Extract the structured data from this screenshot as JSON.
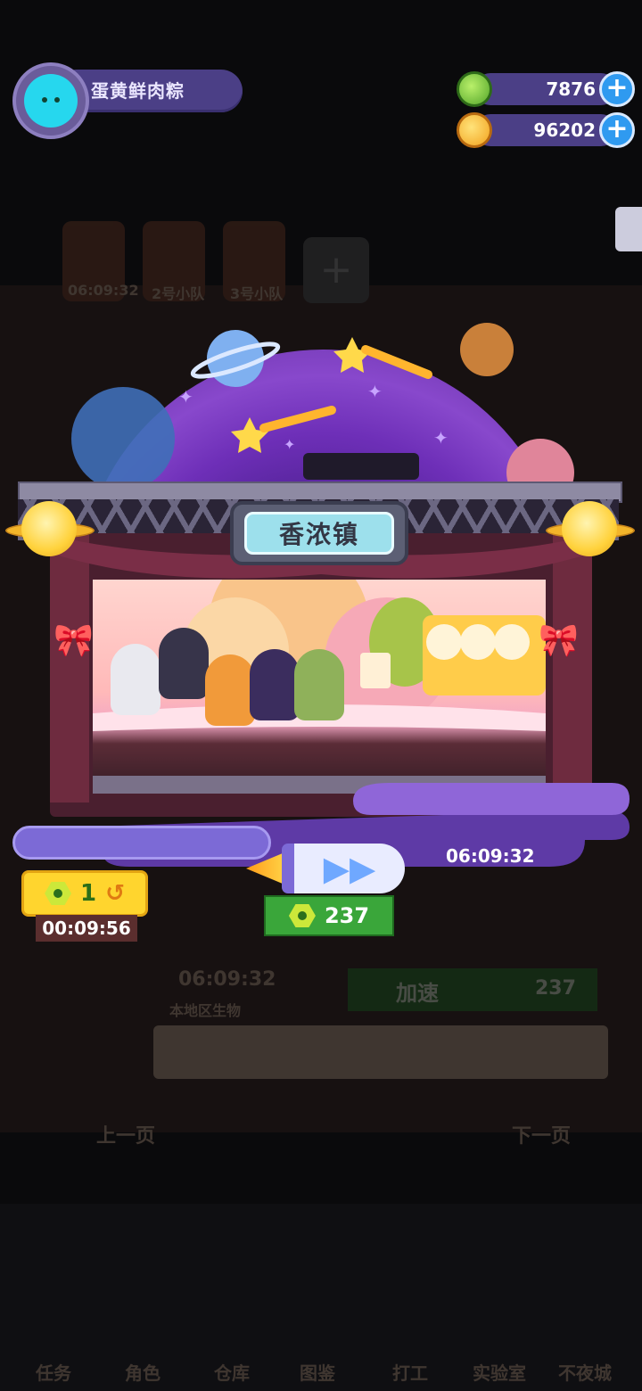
{
  "player": {
    "name": "蛋黄鲜肉粽"
  },
  "currencies": [
    {
      "name": "green-gem",
      "value": "7876",
      "color": "#6fc83a"
    },
    {
      "name": "gold-coin",
      "value": "96202",
      "color": "#f4b21c"
    }
  ],
  "stage": {
    "location_sign": "香浓镇",
    "end_timer": "06:09:32"
  },
  "speedup": {
    "cost": "237",
    "free_count": "1",
    "free_timer": "00:09:56"
  },
  "background": {
    "team_tabs": [
      "06:09:32",
      "2号小队",
      "3号小队"
    ],
    "timer": "06:09:32",
    "region_label": "本地区生物",
    "speed_label": "加速",
    "speed_cost": "237",
    "prev_page": "上一页",
    "next_page": "下一页",
    "nav_items": [
      "任务",
      "角色",
      "仓库",
      "图鉴",
      "打工",
      "实验室",
      "不夜城"
    ]
  }
}
